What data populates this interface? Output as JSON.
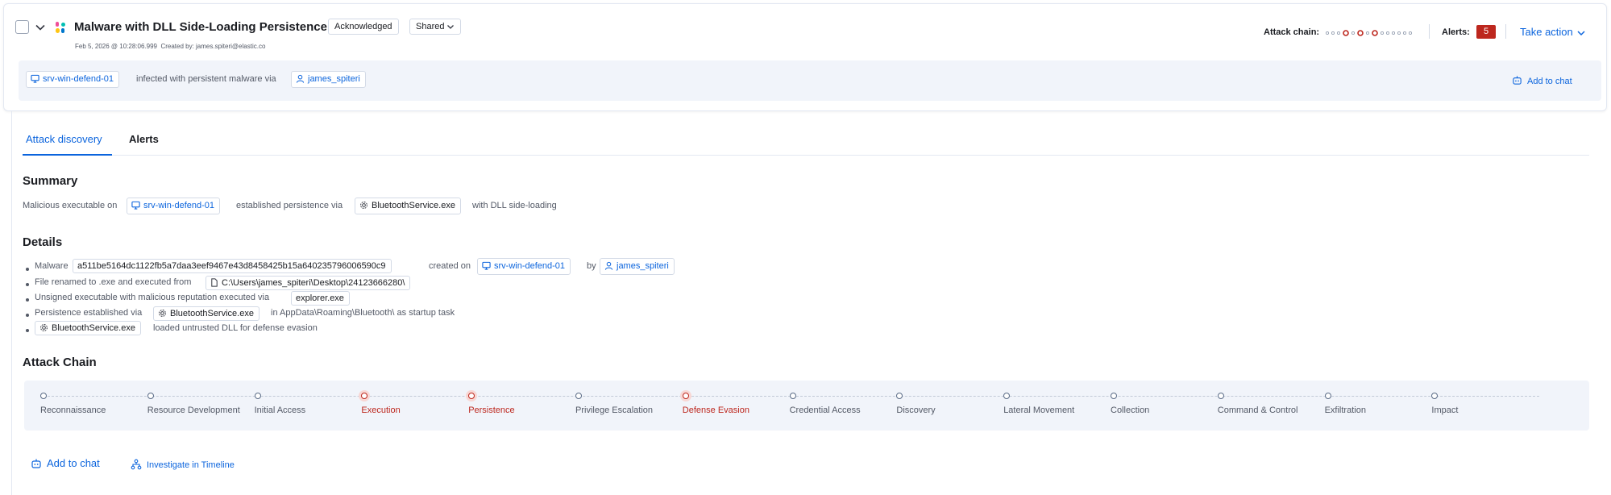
{
  "header": {
    "title": "Malware with DLL Side-Loading Persistence",
    "status_badge": "Acknowledged",
    "shared_label": "Shared",
    "timestamp": "Feb 5, 2026 @ 10:28:06.999",
    "created_by": "Created by: james.spiteri@elastic.co",
    "attack_chain_label": "Attack chain:",
    "alerts_label": "Alerts:",
    "alerts_count": "5",
    "take_action_label": "Take action"
  },
  "banner": {
    "host": "srv-win-defend-01",
    "text": "infected with persistent malware via",
    "user": "james_spiteri",
    "add_to_chat": "Add to chat"
  },
  "tabs": [
    {
      "label": "Attack discovery",
      "active": true
    },
    {
      "label": "Alerts",
      "active": false
    }
  ],
  "summary": {
    "heading": "Summary",
    "prefix": "Malicious executable on",
    "host": "srv-win-defend-01",
    "middle": "established persistence via",
    "process": "BluetoothService.exe",
    "suffix": "with DLL side-loading"
  },
  "details": {
    "heading": "Details",
    "line1": {
      "prefix": "Malware",
      "hash": "a511be5164dc1122fb5a7daa3eef9467e43d8458425b15a640235796006590c9",
      "created_on": "created on",
      "host": "srv-win-defend-01",
      "by": "by",
      "user": "james_spiteri"
    },
    "line2": {
      "prefix": "File renamed to .exe and executed from",
      "path": "C:\\Users\\james_spiteri\\Desktop\\24123666280\\"
    },
    "line3": {
      "prefix": "Unsigned executable with malicious reputation executed via",
      "process": "explorer.exe"
    },
    "line4": {
      "prefix": "Persistence established via",
      "process": "BluetoothService.exe",
      "suffix": "in AppData\\Roaming\\Bluetooth\\ as startup task"
    },
    "line5": {
      "process": "BluetoothService.exe",
      "suffix": "loaded untrusted DLL for defense evasion"
    }
  },
  "attack_chain": {
    "heading": "Attack Chain",
    "stages": [
      {
        "label": "Reconnaissance",
        "detected": false
      },
      {
        "label": "Resource Development",
        "detected": false
      },
      {
        "label": "Initial Access",
        "detected": false
      },
      {
        "label": "Execution",
        "detected": true
      },
      {
        "label": "Persistence",
        "detected": true
      },
      {
        "label": "Privilege Escalation",
        "detected": false
      },
      {
        "label": "Defense Evasion",
        "detected": true
      },
      {
        "label": "Credential Access",
        "detected": false
      },
      {
        "label": "Discovery",
        "detected": false
      },
      {
        "label": "Lateral Movement",
        "detected": false
      },
      {
        "label": "Collection",
        "detected": false
      },
      {
        "label": "Command & Control",
        "detected": false
      },
      {
        "label": "Exfiltration",
        "detected": false
      },
      {
        "label": "Impact",
        "detected": false
      }
    ]
  },
  "footer": {
    "add_to_chat": "Add to chat",
    "investigate": "Investigate in Timeline"
  },
  "colors": {
    "accent": "#0b64dd",
    "danger": "#bd271e",
    "panel_bg": "#f1f4fa"
  }
}
